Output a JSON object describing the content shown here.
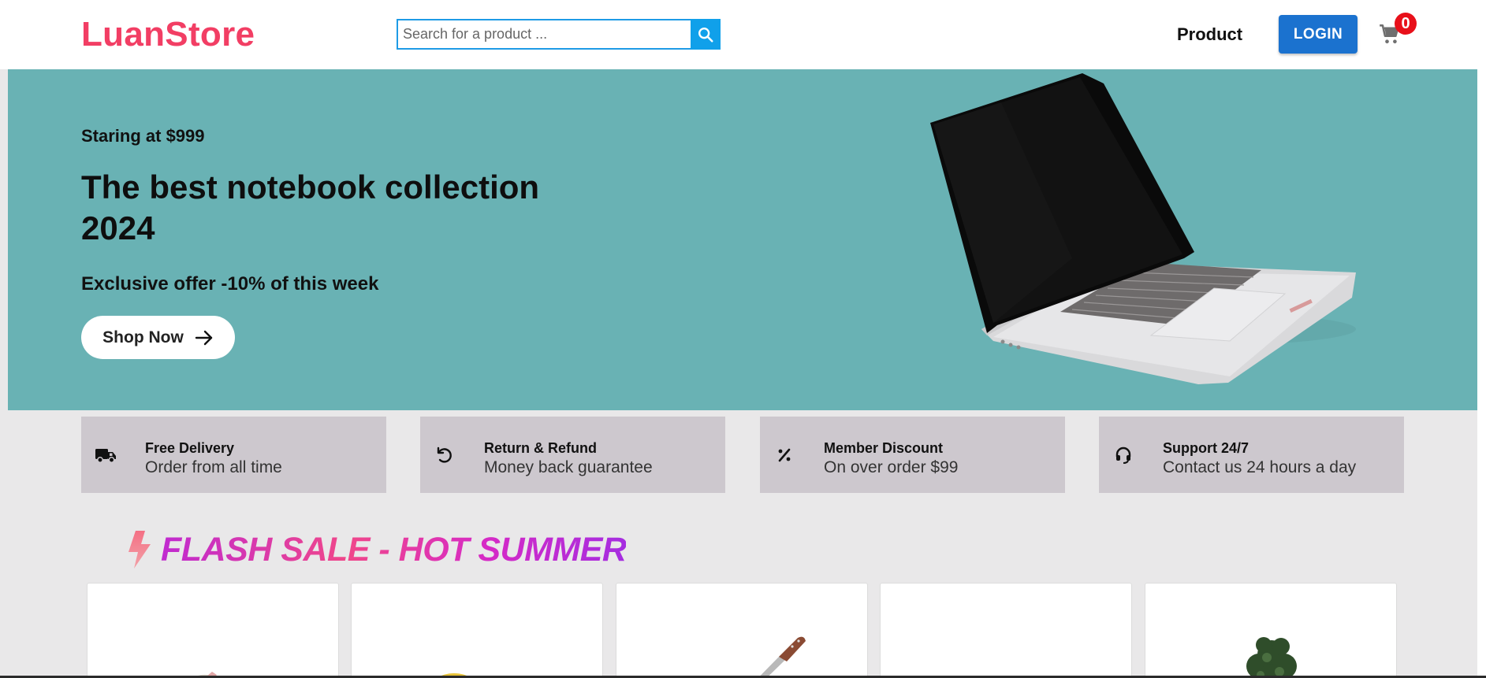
{
  "header": {
    "logo": "LuanStore",
    "search_placeholder": "Search for a product ...",
    "nav_product": "Product",
    "login_label": "LOGIN",
    "cart_count": "0"
  },
  "hero": {
    "kicker": "Staring at $999",
    "title": "The best notebook collection 2024",
    "offer": "Exclusive offer -10% of this week",
    "cta_label": "Shop Now"
  },
  "features": [
    {
      "title": "Free Delivery",
      "subtitle": "Order from all time",
      "icon": "truck-icon"
    },
    {
      "title": "Return & Refund",
      "subtitle": "Money back guarantee",
      "icon": "refund-icon"
    },
    {
      "title": "Member Discount",
      "subtitle": "On over order $99",
      "icon": "percent-icon"
    },
    {
      "title": "Support 24/7",
      "subtitle": "Contact us 24 hours a day",
      "icon": "headset-icon"
    }
  ],
  "flash_sale": {
    "title": "FLASH SALE - HOT SUMMER",
    "icon": "lightning-icon"
  },
  "colors": {
    "brand": "#f23e64",
    "hero_bg": "#69b2b4",
    "login_bg": "#1b72cf",
    "search_btn": "#10a0ea",
    "feature_bg": "#cdc8ce",
    "badge": "#e8101a"
  }
}
